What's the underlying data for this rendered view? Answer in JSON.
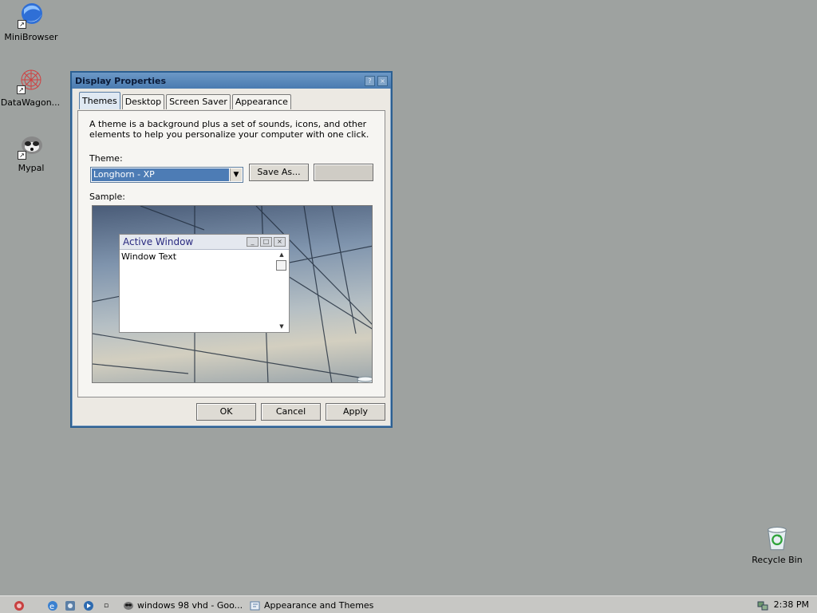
{
  "desktop": {
    "icons": [
      {
        "label": "MiniBrowser"
      },
      {
        "label": "DataWagon..."
      },
      {
        "label": "Mypal"
      }
    ],
    "recycle_bin": "Recycle Bin"
  },
  "window": {
    "title": "Display Properties",
    "tabs": [
      "Themes",
      "Desktop",
      "Screen Saver",
      "Appearance"
    ],
    "active_tab": "Themes",
    "description": "A theme is a background plus a set of sounds, icons, and other elements to help you personalize your computer with one click.",
    "theme_label": "Theme:",
    "theme_value": "Longhorn - XP",
    "save_as_label": "Save As...",
    "delete_label": "",
    "sample_label": "Sample:",
    "sample": {
      "window_title": "Active Window",
      "window_text": "Window Text"
    },
    "buttons": {
      "ok": "OK",
      "cancel": "Cancel",
      "apply": "Apply"
    }
  },
  "taskbar": {
    "tasks": [
      "windows 98 vhd - Goo...",
      "Appearance and Themes"
    ],
    "clock": "2:38 PM"
  }
}
